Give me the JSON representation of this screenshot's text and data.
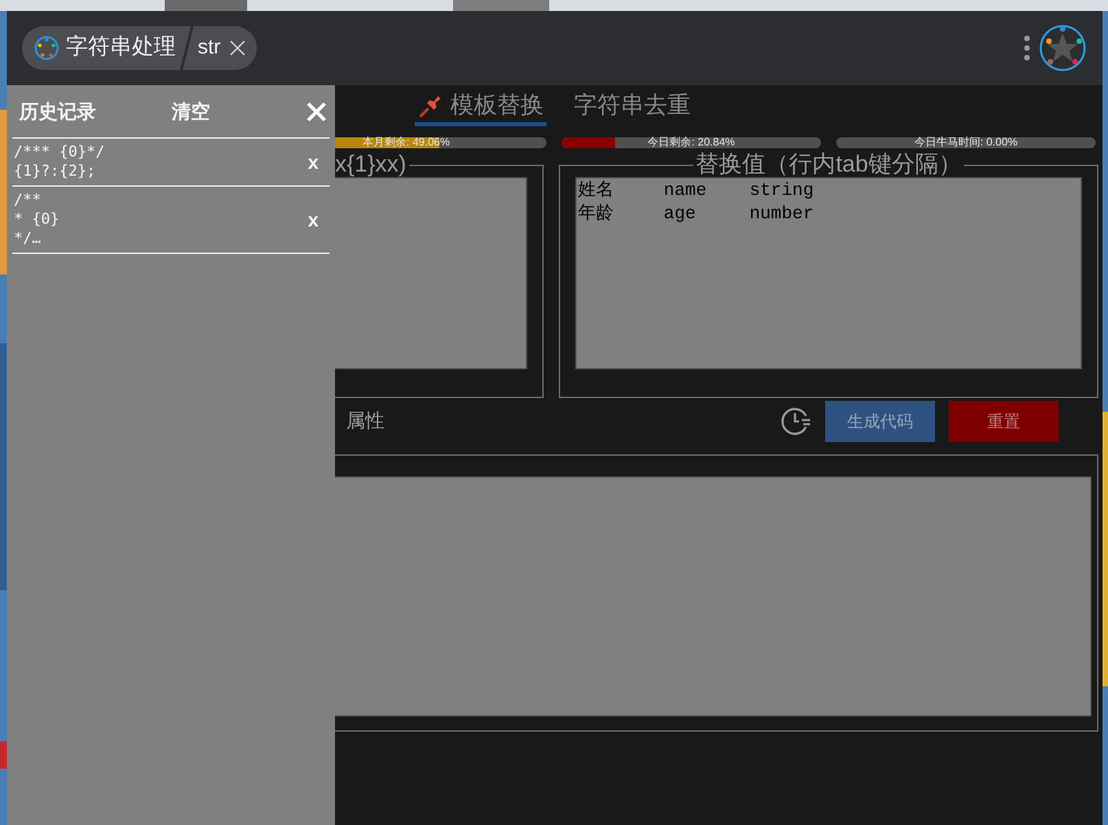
{
  "titlebar": {
    "app_tab": {
      "label": "字符串处理",
      "sub_label": "str"
    }
  },
  "tabs": [
    {
      "label": "模板替换",
      "selected": true
    },
    {
      "label": "字符串去重",
      "selected": false
    }
  ],
  "meters": [
    {
      "label": "本月剩余: 49.06%",
      "level": 0.4906,
      "color": "#b8860b"
    },
    {
      "label": "今日剩余: 20.84%",
      "level": 0.2084,
      "color": "#8b0000"
    },
    {
      "label": "今日牛马时间: 0.00%",
      "level": 0
    }
  ],
  "template_panel": {
    "legend": "x{1}xx)"
  },
  "values_panel": {
    "legend": "替换值（行内tab键分隔）",
    "value": "姓名\tname\tstring\n年龄\tage\tnumber"
  },
  "options": {
    "label": "属性"
  },
  "buttons": [
    {
      "label": "生成代码",
      "kind": "primary"
    },
    {
      "label": "重置",
      "kind": "danger"
    }
  ],
  "history": {
    "title": "历史记录",
    "clear": "清空",
    "items": [
      {
        "text": "/*** {0}*/\n{1}?:{2};",
        "remove": "x"
      },
      {
        "text": "/**\n* {0}\n*/…",
        "remove": "x"
      }
    ]
  }
}
